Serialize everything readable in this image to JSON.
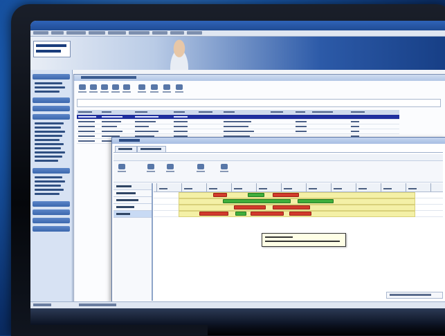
{
  "colors": {
    "accent_blue": "#2f63b8",
    "selection": "#1f2f9e",
    "gantt_band": "#f4f0a6",
    "gantt_red": "#d23b2c",
    "gantt_green": "#3fae3c"
  },
  "icons": [
    "window-logo-icon",
    "person-photo",
    "toolbar-icons",
    "gantt-bars"
  ],
  "note": ""
}
